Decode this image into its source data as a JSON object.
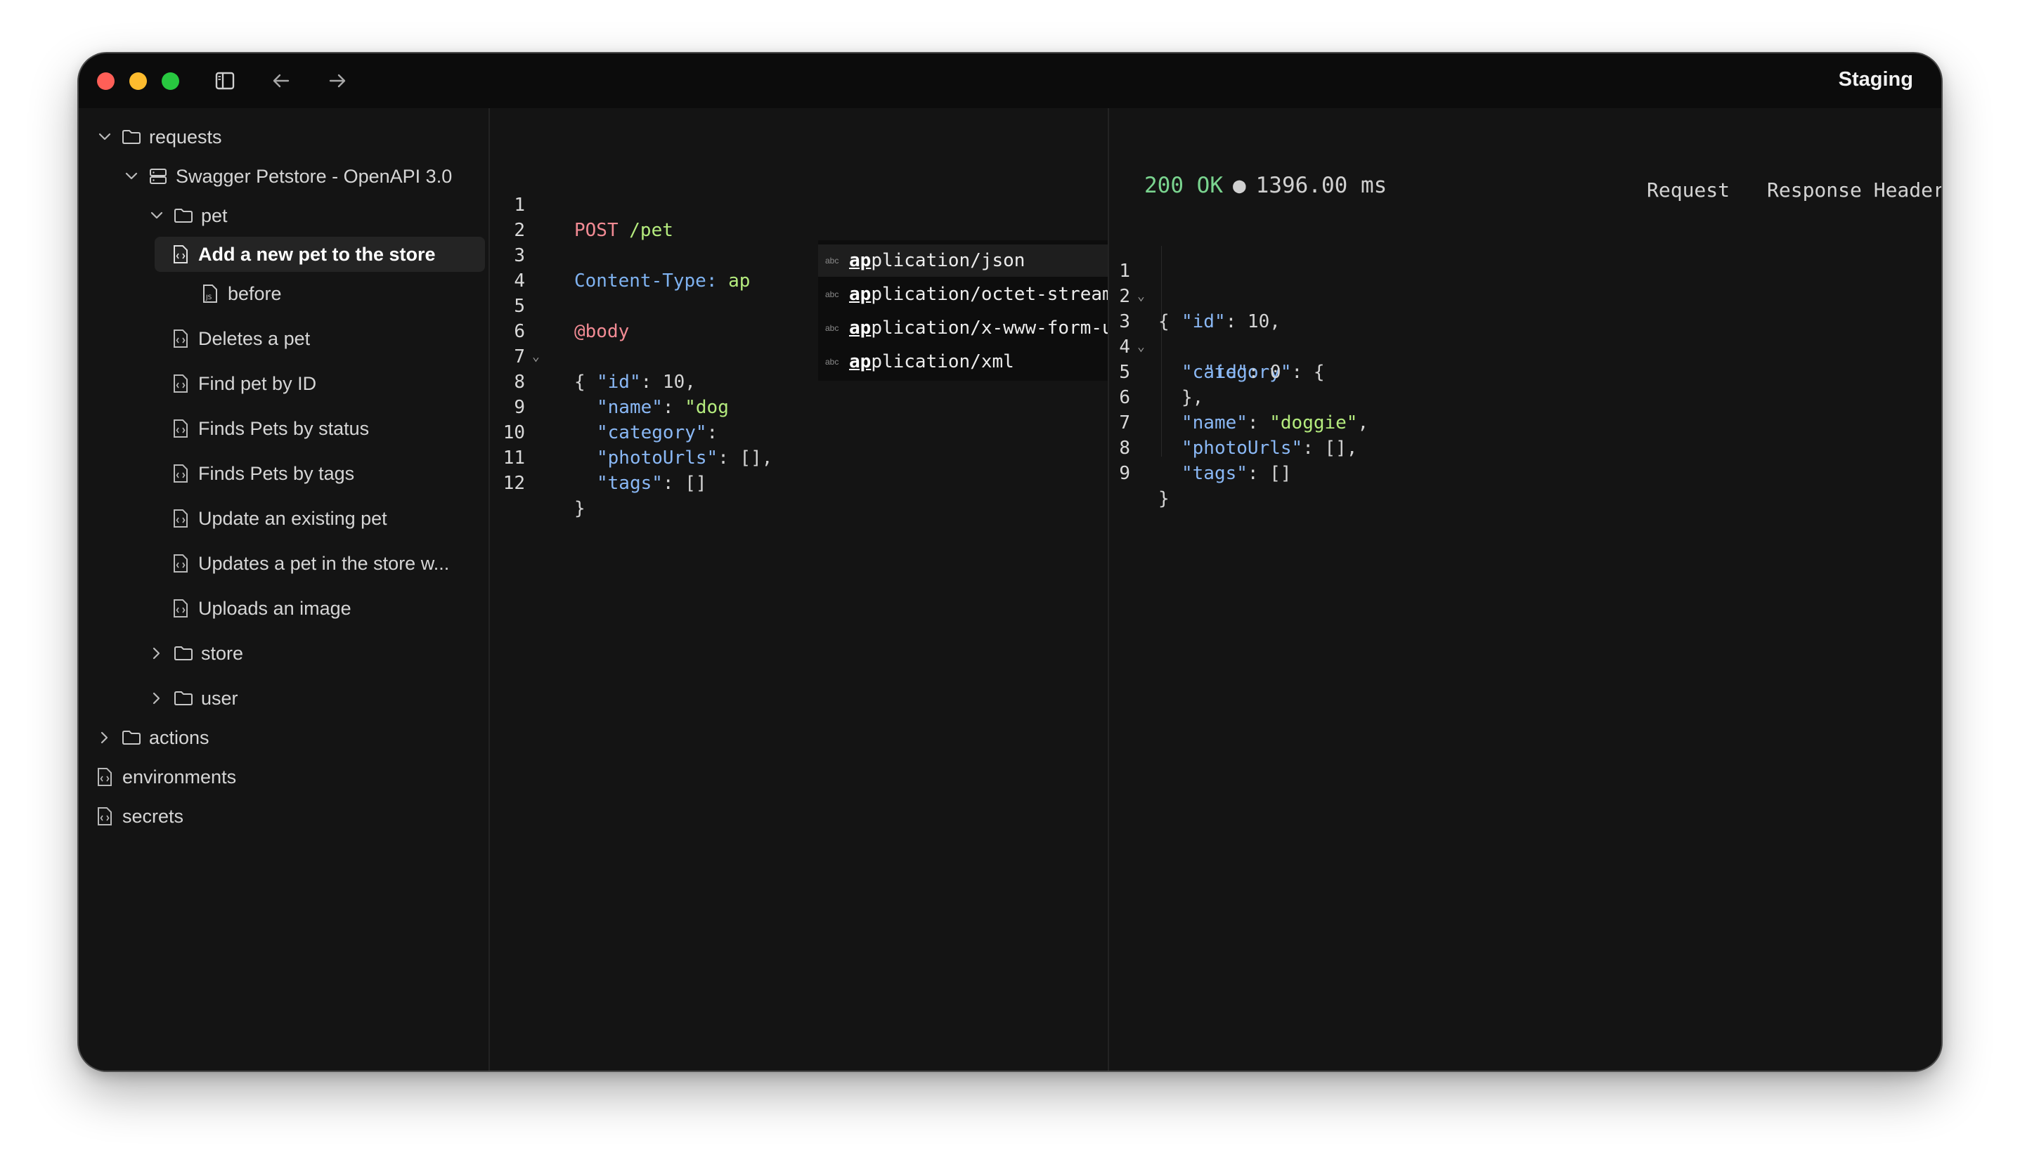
{
  "window": {
    "title": "Staging"
  },
  "sidebar": {
    "items": [
      {
        "label": "requests"
      },
      {
        "label": "Swagger Petstore - OpenAPI 3.0"
      },
      {
        "label": "pet"
      },
      {
        "label": "Add a new pet to the store"
      },
      {
        "label": "before"
      },
      {
        "label": "Deletes a pet"
      },
      {
        "label": "Find pet by ID"
      },
      {
        "label": "Finds Pets by status"
      },
      {
        "label": "Finds Pets by tags"
      },
      {
        "label": "Update an existing pet"
      },
      {
        "label": "Updates a pet in the store w..."
      },
      {
        "label": "Uploads an image"
      },
      {
        "label": "store"
      },
      {
        "label": "user"
      },
      {
        "label": "actions"
      },
      {
        "label": "environments"
      },
      {
        "label": "secrets"
      }
    ]
  },
  "editor": {
    "lines": [
      {
        "n": "1",
        "method": "POST",
        "path": "/pet"
      },
      {
        "n": "2"
      },
      {
        "n": "3",
        "header": "Content-Type:",
        "value": "ap"
      },
      {
        "n": "4"
      },
      {
        "n": "5",
        "directive": "@body"
      },
      {
        "n": "6",
        "text": "{"
      },
      {
        "n": "7",
        "key": "\"id\"",
        "rest": ": 10,"
      },
      {
        "n": "8",
        "key": "\"name\"",
        "sep": ": ",
        "str": "\"dog"
      },
      {
        "n": "9",
        "key": "\"category\"",
        "rest": ":"
      },
      {
        "n": "10",
        "key": "\"photoUrls\"",
        "rest": ": [],"
      },
      {
        "n": "11",
        "key": "\"tags\"",
        "rest": ": []"
      },
      {
        "n": "12",
        "text": "}"
      }
    ],
    "autocomplete": [
      {
        "kind": "abc",
        "match": "ap",
        "rest": "plication/json"
      },
      {
        "kind": "abc",
        "match": "ap",
        "rest": "plication/octet-stream"
      },
      {
        "kind": "abc",
        "match": "ap",
        "rest": "plication/x-www-form-urlencoded"
      },
      {
        "kind": "abc",
        "match": "ap",
        "rest": "plication/xml"
      }
    ]
  },
  "response": {
    "status": "200 OK",
    "separator": "●",
    "time": "1396.00 ms",
    "tabs": [
      "Request",
      "Response Headers"
    ],
    "lines": [
      {
        "n": "1",
        "text": "{"
      },
      {
        "n": "2",
        "key": "\"id\"",
        "rest": ": 10,"
      },
      {
        "n": "3",
        "key": "\"category\"",
        "rest": ": {"
      },
      {
        "n": "4",
        "key": "\"id\"",
        "rest": ": 0"
      },
      {
        "n": "5",
        "text": "},"
      },
      {
        "n": "6",
        "key": "\"name\"",
        "sep": ": ",
        "str": "\"doggie\"",
        "rest": ","
      },
      {
        "n": "7",
        "key": "\"photoUrls\"",
        "rest": ": [],"
      },
      {
        "n": "8",
        "key": "\"tags\"",
        "rest": ": []"
      },
      {
        "n": "9",
        "text": "}"
      }
    ]
  },
  "colors": {
    "window_bg": "#141414",
    "selected_row": "#242424",
    "status_ok": "#7ad48f",
    "method": "#f28b94",
    "string": "#b5ec7e",
    "key": "#8ab8f5"
  },
  "icons": [
    "sidebar-toggle-icon",
    "arrow-left-icon",
    "arrow-right-icon",
    "chevron-down-icon",
    "chevron-right-icon",
    "folder-icon",
    "server-icon",
    "file-code-icon",
    "file-js-icon"
  ]
}
